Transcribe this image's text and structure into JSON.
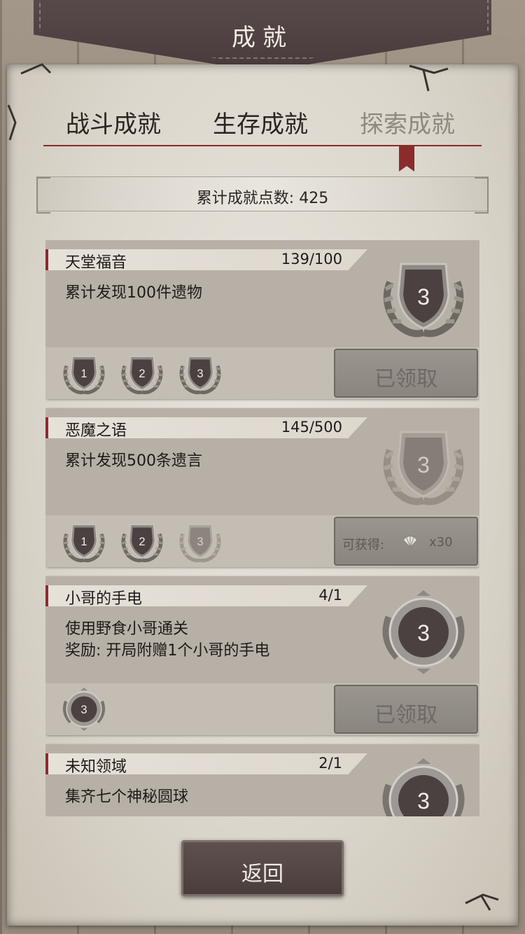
{
  "header": {
    "title": "成就"
  },
  "tabs": [
    "战斗成就",
    "生存成就",
    "探索成就"
  ],
  "active_tab_index": 2,
  "points": {
    "text": "累计成就点数: 425"
  },
  "achievements": [
    {
      "name": "天堂福音",
      "progress": "139/100",
      "desc_lines": [
        "累计发现100件遗物"
      ],
      "big_badge_level": "3",
      "big_badge_style": "shield",
      "big_badge_dim": false,
      "small_badges": [
        {
          "level": "1",
          "dim": false
        },
        {
          "level": "2",
          "dim": false
        },
        {
          "level": "3",
          "dim": false
        }
      ],
      "button": {
        "type": "claimed",
        "label": "已领取"
      }
    },
    {
      "name": "恶魔之语",
      "progress": "145/500",
      "desc_lines": [
        "累计发现500条遗言"
      ],
      "big_badge_level": "3",
      "big_badge_style": "shield",
      "big_badge_dim": true,
      "small_badges": [
        {
          "level": "1",
          "dim": false
        },
        {
          "level": "2",
          "dim": false
        },
        {
          "level": "3",
          "dim": true
        }
      ],
      "button": {
        "type": "reward",
        "label": "可获得:",
        "count": "x30",
        "icon": "shell-icon"
      }
    },
    {
      "name": "小哥的手电",
      "progress": "4/1",
      "desc_lines": [
        "使用野食小哥通关",
        "奖励: 开局附赠1个小哥的手电"
      ],
      "big_badge_level": "3",
      "big_badge_style": "round",
      "big_badge_dim": false,
      "small_badges": [
        {
          "level": "3",
          "dim": false,
          "style": "round"
        }
      ],
      "button": {
        "type": "claimed",
        "label": "已领取"
      }
    },
    {
      "name": "未知领域",
      "progress": "2/1",
      "desc_lines": [
        "集齐七个神秘圆球"
      ],
      "big_badge_level": "3",
      "big_badge_style": "round",
      "big_badge_dim": false,
      "small_badges": [],
      "button": {
        "type": "none"
      }
    }
  ],
  "back_button": {
    "label": "返回"
  },
  "colors": {
    "accent": "#8b2c2c",
    "header": "#4a3c3d",
    "paper": "#dcd7cd"
  }
}
